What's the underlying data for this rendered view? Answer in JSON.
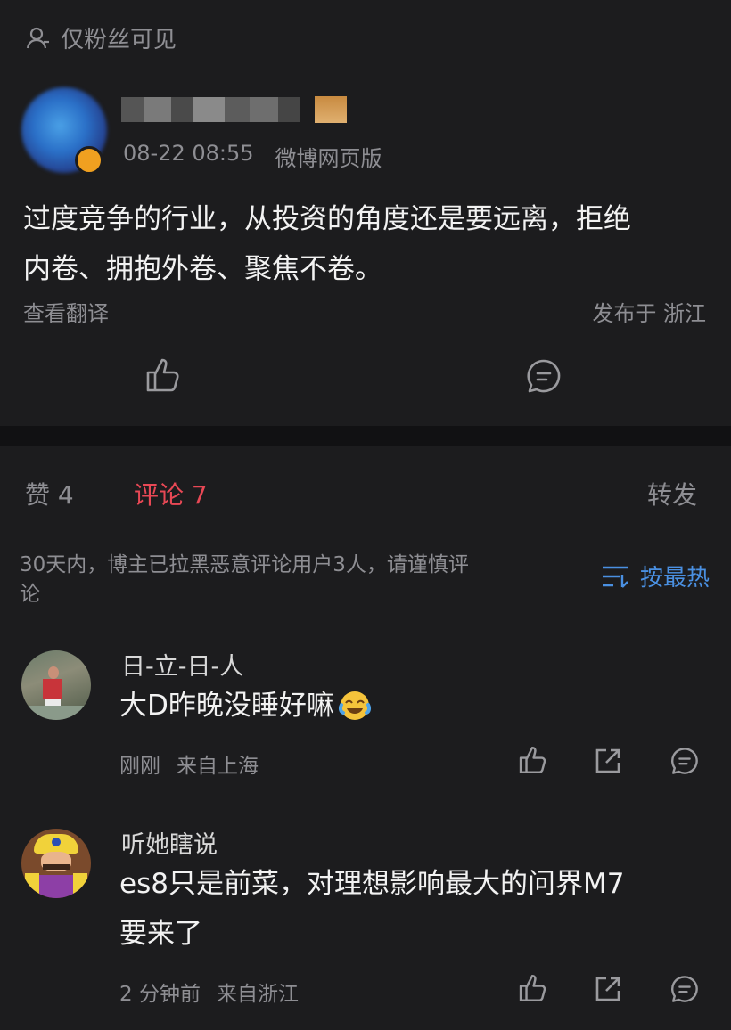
{
  "visibility": {
    "icon": "person-icon",
    "label": "仅粉丝可见"
  },
  "post": {
    "author_avatar": "avatar",
    "time": "08-22 08:55",
    "source": "微博网页版",
    "text_line1": "过度竞争的行业，从投资的角度还是要远离，拒绝",
    "text_line2": "内卷、拥抱外卷、聚焦不卷。",
    "translate": "查看翻译",
    "location": "发布于 浙江"
  },
  "tabs": {
    "likes": "赞 4",
    "comments": "评论 7",
    "repost": "转发"
  },
  "notice": {
    "line1": "30天内，博主已拉黑恶意评论用户3人，请谨慎评",
    "line2": "论"
  },
  "sort": {
    "icon": "sort-icon",
    "label": "按最热"
  },
  "comments": [
    {
      "name": "日-立-日-人",
      "text": "大D昨晚没睡好嘛",
      "emoji": "laugh-cry-emoji",
      "time": "刚刚",
      "location": "来自上海"
    },
    {
      "name": "听她瞎说",
      "text_line1": "es8只是前菜，对理想影响最大的问界M7",
      "text_line2": "要来了",
      "time": "2 分钟前",
      "location": "来自浙江"
    }
  ],
  "colors": {
    "accent": "#e84855",
    "link_blue": "#4a90e2",
    "background": "#1c1c1e"
  }
}
